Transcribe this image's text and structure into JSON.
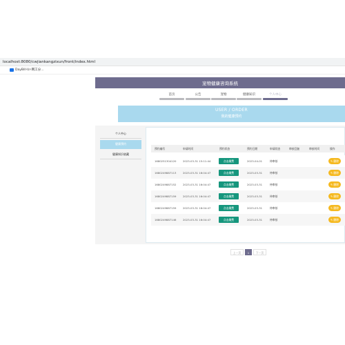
{
  "browser": {
    "url": "localhost:8080/cwjiankangzixun/front/index.html",
    "bookmark_label": "DayBill·Ur-网工分..."
  },
  "site": {
    "title": "宠物健康咨询系统"
  },
  "nav": {
    "items": [
      {
        "label": "首页"
      },
      {
        "label": "公告"
      },
      {
        "label": "宠物"
      },
      {
        "label": "健康知识"
      },
      {
        "label": "个人中心"
      }
    ]
  },
  "banner": {
    "title": "USER / ORDER",
    "subtitle": "我的健康预约"
  },
  "sidebar": {
    "items": [
      {
        "label": "个人中心"
      },
      {
        "label": "健康预约"
      },
      {
        "label": "健康知识收藏"
      }
    ]
  },
  "table": {
    "headers": [
      "预约编号",
      "申请时间",
      "预约状态",
      "预约日期",
      "申请状态",
      "审核回复",
      "审核时间",
      "操作"
    ],
    "rows": [
      {
        "id": "1680251304120",
        "time": "2023-03-31 15:11:44",
        "pay": "点击缴费",
        "date": "2023-04-01",
        "status": "待审核",
        "del": "删除"
      },
      {
        "id": "1680249887113",
        "time": "2023-03-31 16:04:47",
        "pay": "点击缴费",
        "date": "2023-03-31",
        "status": "待审核",
        "del": "删除"
      },
      {
        "id": "1680249887152",
        "time": "2023-03-31 16:04:47",
        "pay": "点击缴费",
        "date": "2023-03-31",
        "status": "待审核",
        "del": "删除"
      },
      {
        "id": "1680249887159",
        "time": "2023-03-31 16:04:47",
        "pay": "点击缴费",
        "date": "2023-03-31",
        "status": "待审核",
        "del": "删除"
      },
      {
        "id": "1680249887159",
        "time": "2023-03-31 16:04:47",
        "pay": "点击缴费",
        "date": "2023-03-31",
        "status": "待审核",
        "del": "删除"
      },
      {
        "id": "1680249887146",
        "time": "2023-03-31 16:04:47",
        "pay": "点击缴费",
        "date": "2023-03-31",
        "status": "待审核",
        "del": "删除"
      }
    ]
  },
  "pager": {
    "prev": "上一页",
    "current": "1",
    "next": "下一页"
  },
  "colors": {
    "header": "#6e6c8e",
    "banner": "#a9d9ee",
    "pay_button": "#16967d",
    "delete_button": "#f5b920"
  }
}
